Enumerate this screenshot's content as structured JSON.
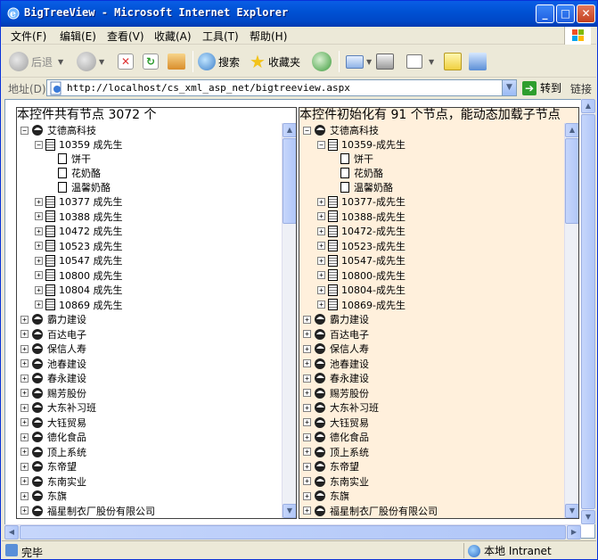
{
  "window": {
    "title": "BigTreeView - Microsoft Internet Explorer",
    "minimize": "_",
    "maximize": "□",
    "close": "✕"
  },
  "menu": [
    "文件(F)",
    "编辑(E)",
    "查看(V)",
    "收藏(A)",
    "工具(T)",
    "帮助(H)"
  ],
  "toolbar": {
    "back": "后退",
    "search": "搜索",
    "favorites": "收藏夹"
  },
  "address": {
    "label": "地址(D)",
    "url": "http://localhost/cs_xml_asp_net/bigtreeview.aspx",
    "go": "转到",
    "links": "链接"
  },
  "left_pane": {
    "title": "本控件共有节点 3072 个",
    "root": "艾德高科技",
    "expanded_child": "10359 成先生",
    "leaves": [
      "饼干",
      "花奶酪",
      "温馨奶酪"
    ],
    "children": [
      "10377 成先生",
      "10388 成先生",
      "10472 成先生",
      "10523 成先生",
      "10547 成先生",
      "10800 成先生",
      "10804 成先生",
      "10869 成先生"
    ]
  },
  "right_pane": {
    "title": "本控件初始化有 91 个节点，能动态加载子节点",
    "root": "艾德高科技",
    "expanded_child": "10359-成先生",
    "leaves": [
      "饼干",
      "花奶酪",
      "温馨奶酪"
    ],
    "children": [
      "10377-成先生",
      "10388-成先生",
      "10472-成先生",
      "10523-成先生",
      "10547-成先生",
      "10800-成先生",
      "10804-成先生",
      "10869-成先生"
    ]
  },
  "companies": [
    "霸力建设",
    "百达电子",
    "保信人寿",
    "池春建设",
    "春永建设",
    "赐芳股份",
    "大东补习班",
    "大钰贸易",
    "德化食品",
    "顶上系统",
    "东帝望",
    "东南实业",
    "东旗",
    "福星制衣厂股份有限公司"
  ],
  "status": {
    "text": "完毕",
    "zone": "本地 Intranet"
  },
  "colors": {
    "titlebar": "#0054e3",
    "right_pane_bg": "#fff0dc"
  }
}
